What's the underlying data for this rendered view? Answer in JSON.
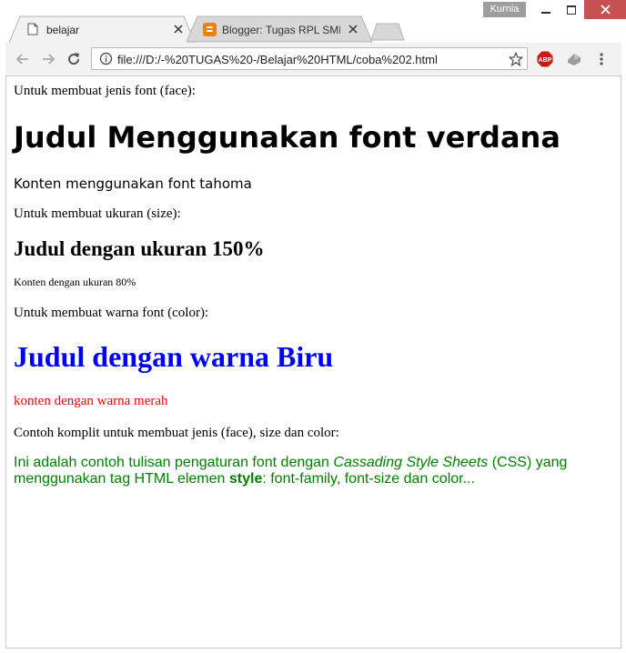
{
  "window": {
    "user_name": "Kurnia"
  },
  "tabs": [
    {
      "label": "belajar",
      "active": true
    },
    {
      "label": "Blogger: Tugas RPL SMK",
      "active": false
    }
  ],
  "toolbar": {
    "url": "file:///D:/-%20TUGAS%20-/Belajar%20HTML/coba%202.html",
    "adblock_label": "ABP"
  },
  "colors": {
    "blue_heading": "#0000ff",
    "red_text": "#ff0000",
    "green_text": "#008000",
    "close_button": "#c75050"
  },
  "content": {
    "face_intro": "Untuk membuat jenis font (face):",
    "verdana_heading": "Judul Menggunakan font verdana",
    "tahoma_paragraph": "Konten menggunakan font tahoma",
    "size_intro": "Untuk membuat ukuran (size):",
    "size_heading": "Judul dengan ukuran 150%",
    "size_paragraph": "Konten dengan ukuran 80%",
    "color_intro": "Untuk membuat warna font (color):",
    "color_heading": "Judul dengan warna Biru",
    "color_paragraph": "konten dengan warna merah",
    "complete_intro": "Contoh komplit untuk membuat jenis (face), size dan color:",
    "complete_part1": "Ini adalah contoh tulisan pengaturan font dengan ",
    "complete_italic": "Cassading Style Sheets",
    "complete_part2": " (CSS) yang menggunakan tag HTML elemen ",
    "complete_bold": "style",
    "complete_part3": ": font-family, font-size dan color..."
  }
}
